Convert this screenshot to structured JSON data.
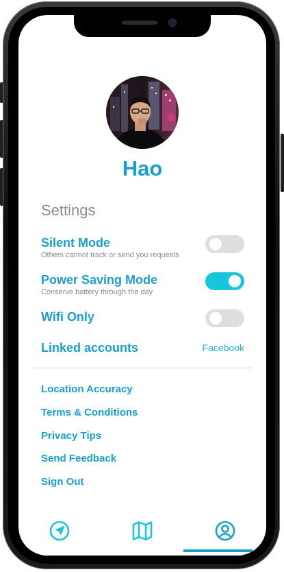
{
  "profile": {
    "name": "Hao"
  },
  "settings": {
    "title": "Settings",
    "items": [
      {
        "label": "Silent Mode",
        "description": "Others cannot track or send you requests",
        "enabled": false
      },
      {
        "label": "Power Saving Mode",
        "description": "Conserve battery through the day",
        "enabled": true
      },
      {
        "label": "Wifi Only",
        "description": "",
        "enabled": false
      }
    ],
    "linked": {
      "label": "Linked accounts",
      "value": "Facebook"
    }
  },
  "links": [
    "Location Accuracy",
    "Terms & Conditions",
    "Privacy Tips",
    "Send Feedback",
    "Sign Out"
  ],
  "tabs": [
    {
      "icon": "navigation-icon",
      "active": false
    },
    {
      "icon": "map-icon",
      "active": false
    },
    {
      "icon": "profile-icon",
      "active": true
    }
  ],
  "colors": {
    "accent": "#1a9fd0",
    "toggle_on": "#18c6dc",
    "toggle_off": "#dedede",
    "muted_text": "#8c8c8c"
  }
}
